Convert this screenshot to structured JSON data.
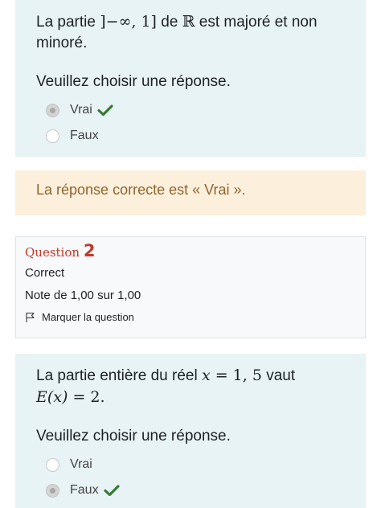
{
  "question1": {
    "text_prefix": "La partie ",
    "interval": "]−∞, 1]",
    "text_mid": " de ",
    "set_symbol": "ℝ",
    "text_suffix": " est majoré et non minoré.",
    "prompt": "Veuillez choisir une réponse.",
    "options": [
      {
        "label": "Vrai",
        "selected": true,
        "correct_mark": true
      },
      {
        "label": "Faux",
        "selected": false,
        "correct_mark": false
      }
    ]
  },
  "feedback": {
    "text": "La réponse correcte est « Vrai »."
  },
  "question2_info": {
    "title": "Question",
    "number": "2",
    "state": "Correct",
    "grade": "Note de 1,00 sur 1,00",
    "flag_label": "Marquer la question"
  },
  "question2": {
    "text_prefix": "La partie entière du réel ",
    "var_x": "x",
    "eq1": " = 1, 5",
    "text_mid": " vaut",
    "func": "E",
    "func_arg": "(x)",
    "eq2": " = 2.",
    "prompt": "Veuillez choisir une réponse.",
    "options": [
      {
        "label": "Vrai",
        "selected": false,
        "correct_mark": false
      },
      {
        "label": "Faux",
        "selected": true,
        "correct_mark": true
      }
    ]
  },
  "colors": {
    "qtext_bg": "#e7f3f5",
    "feedback_bg": "#fcefdc",
    "feedback_text": "#8e662e",
    "question_number": "#c0392b",
    "check_green": "#357a32"
  },
  "icons": {
    "correct": "check-icon",
    "flag": "flag-icon"
  }
}
